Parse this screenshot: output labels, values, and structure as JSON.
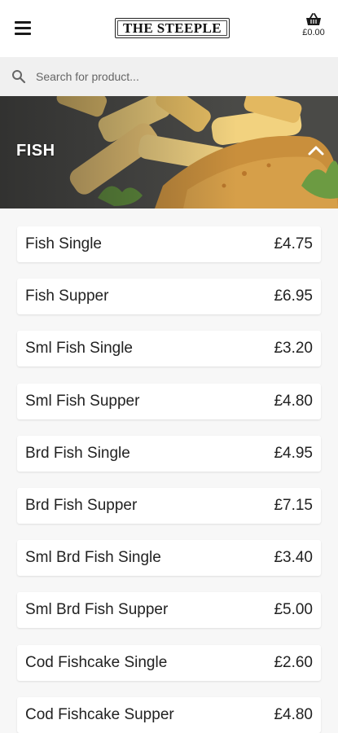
{
  "header": {
    "logo_text": "THE STEEPLE",
    "basket_total": "£0.00"
  },
  "search": {
    "placeholder": "Search for product..."
  },
  "category": {
    "title": "FISH"
  },
  "products": [
    {
      "name": "Fish Single",
      "price": "£4.75"
    },
    {
      "name": "Fish Supper",
      "price": "£6.95"
    },
    {
      "name": "Sml Fish Single",
      "price": "£3.20"
    },
    {
      "name": "Sml Fish Supper",
      "price": "£4.80"
    },
    {
      "name": "Brd Fish Single",
      "price": "£4.95"
    },
    {
      "name": "Brd Fish Supper",
      "price": "£7.15"
    },
    {
      "name": "Sml Brd Fish Single",
      "price": "£3.40"
    },
    {
      "name": "Sml Brd Fish Supper",
      "price": "£5.00"
    },
    {
      "name": "Cod Fishcake Single",
      "price": "£2.60"
    },
    {
      "name": "Cod Fishcake Supper",
      "price": "£4.80"
    }
  ],
  "icons": {
    "menu": "hamburger-menu-icon",
    "basket": "basket-icon",
    "search": "search-icon",
    "collapse": "chevron-up-icon"
  }
}
